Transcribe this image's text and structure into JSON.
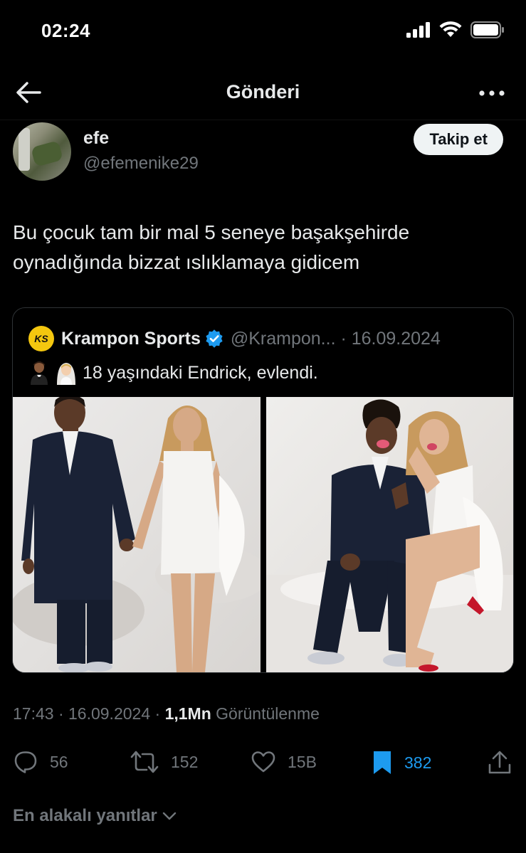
{
  "status_bar": {
    "time": "02:24"
  },
  "nav": {
    "title": "Gönderi"
  },
  "author": {
    "name": "efe",
    "handle": "@efemenike29",
    "follow_label": "Takip et"
  },
  "tweet": {
    "text_line1": "Bu çocuk tam bir mal 5 seneye başakşehirde",
    "text_line2": "oynadığında bizzat ıslıklamaya gidicem"
  },
  "quote": {
    "logo_text": "KS",
    "name": "Krampon Sports",
    "handle_date": "@Krampon... · 16.09.2024",
    "text": "18 yaşındaki Endrick, evlendi."
  },
  "meta": {
    "time_date": "17:43 · 16.09.2024 · ",
    "views_count": "1,1Mn",
    "views_label": " Görüntülenme"
  },
  "actions": {
    "replies": "56",
    "reposts": "152",
    "likes": "15B",
    "bookmarks": "382"
  },
  "replies_sort": {
    "label": "En alakalı yanıtlar"
  },
  "colors": {
    "accent": "#1d9bf0",
    "background": "#000000",
    "muted": "#71767b",
    "logo": "#f4c70f"
  },
  "icons": [
    "back-arrow-icon",
    "more-icon",
    "verified-icon",
    "reply-icon",
    "repost-icon",
    "like-icon",
    "bookmark-icon",
    "share-icon",
    "chevron-down-icon"
  ]
}
